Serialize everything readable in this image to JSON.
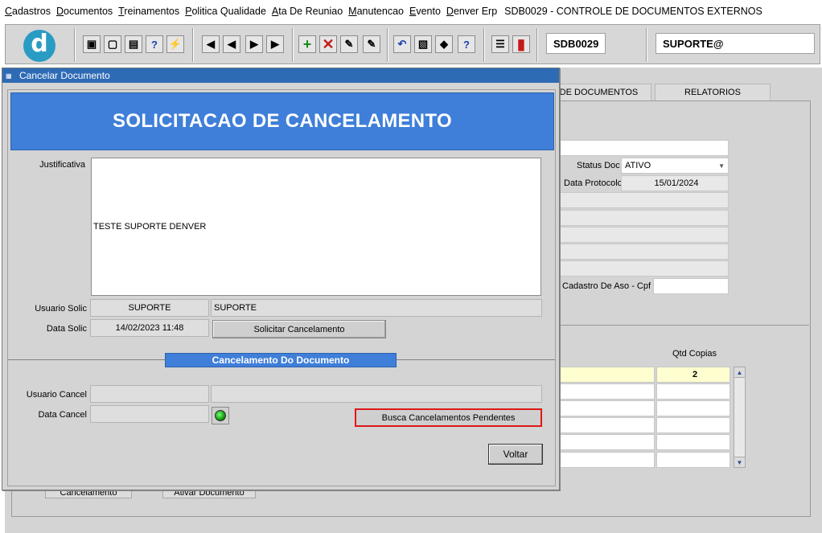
{
  "menu": {
    "items": [
      {
        "u": "C",
        "rest": "adastros"
      },
      {
        "u": "D",
        "rest": "ocumentos"
      },
      {
        "u": "T",
        "rest": "reinamentos"
      },
      {
        "u": "P",
        "rest": "olitica Qualidade"
      },
      {
        "u": "A",
        "rest": "ta De Reuniao"
      },
      {
        "u": "M",
        "rest": "anutencao"
      },
      {
        "u": "E",
        "rest": "vento"
      },
      {
        "u": "D",
        "rest": "enver Erp"
      }
    ],
    "window_title": "SDB0029 - CONTROLE DE DOCUMENTOS EXTERNOS"
  },
  "toolbar": {
    "logo_letter": "d",
    "form_code": "SDB0029",
    "user": "SUPORTE@",
    "icons": [
      "save-icon",
      "monitor-icon",
      "print-icon",
      "query-icon",
      "execute-query-icon",
      "first-record-icon",
      "previous-record-icon",
      "next-record-icon",
      "last-record-icon",
      "insert-record-icon",
      "delete-record-icon",
      "print-preview-icon",
      "edit-icon",
      "undo-icon",
      "clipboard-icon",
      "lock-icon",
      "help-icon",
      "menu-icon",
      "exit-icon"
    ]
  },
  "background": {
    "tabs": [
      "OS DE DOCUMENTOS",
      "RELATORIOS"
    ],
    "status_doc_label": "Status Doc",
    "status_doc_value": "ATIVO",
    "data_protocolo_label": "Data Protocolo",
    "data_protocolo_value": "15/01/2024",
    "cadastro_aso_label": "Cadastro De Aso - Cpf",
    "qtd_copias_label": "Qtd Copias",
    "qtd_copias_value": "2",
    "btn_cancelamento": "Cancelamento",
    "btn_ativar": "Ativar Documento"
  },
  "dialog": {
    "title": "Cancelar Documento",
    "banner": "SOLICITACAO DE CANCELAMENTO",
    "justificativa_label": "Justificativa",
    "justificativa_value": "TESTE SUPORTE DENVER",
    "usuario_solic_label": "Usuario Solic",
    "usuario_solic_code": "SUPORTE",
    "usuario_solic_name": "SUPORTE",
    "data_solic_label": "Data Solic",
    "data_solic_value": "14/02/2023 11:48",
    "solicitar_button": "Solicitar Cancelamento",
    "section_header": "Cancelamento Do Documento",
    "usuario_cancel_label": "Usuario Cancel",
    "usuario_cancel_code": "",
    "usuario_cancel_name": "",
    "data_cancel_label": "Data Cancel",
    "data_cancel_value": "",
    "busca_button": "Busca Cancelamentos Pendentes",
    "voltar_button": "Voltar"
  }
}
